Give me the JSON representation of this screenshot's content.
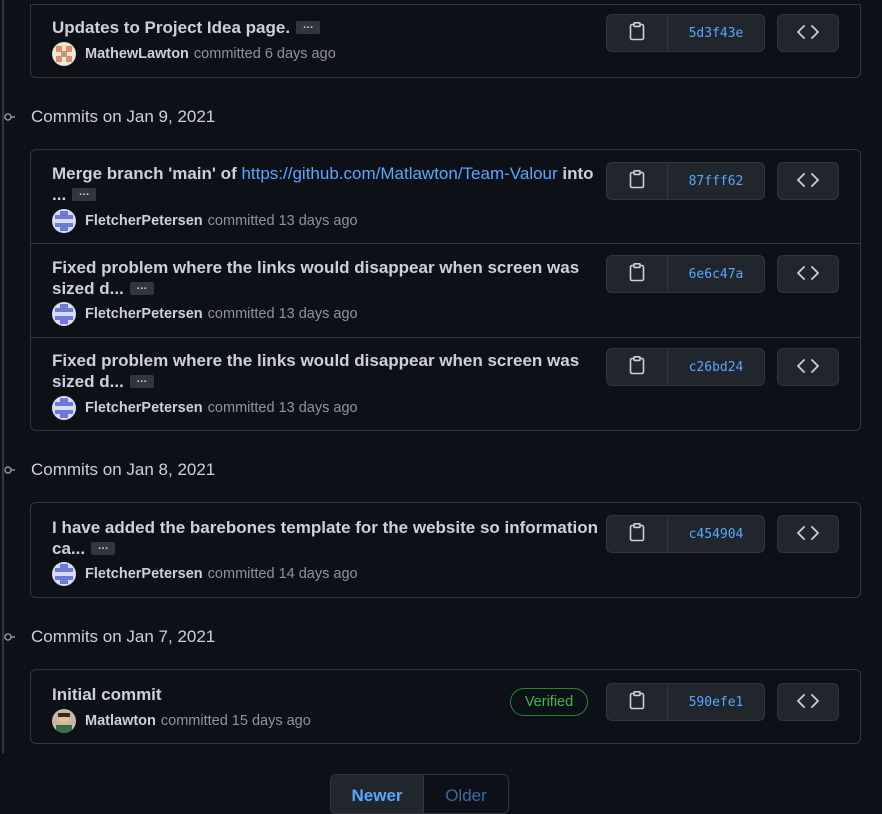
{
  "groups": [
    {
      "header": "",
      "commits": [
        {
          "message": "Updates to Project Idea page.",
          "link": "",
          "message_tail": "",
          "author": "MathewLawton",
          "action": "committed",
          "time": "6 days ago",
          "sha": "5d3f43e",
          "verified": ""
        }
      ]
    },
    {
      "header": "Commits on Jan 9, 2021",
      "commits": [
        {
          "message": "Merge branch 'main' of ",
          "link": "https://github.com/Matlawton/Team-Valour",
          "message_tail": " into ...",
          "author": "FletcherPetersen",
          "action": "committed",
          "time": "13 days ago",
          "sha": "87fff62",
          "verified": ""
        },
        {
          "message": "Fixed problem where the links would disappear when screen was sized d...",
          "link": "",
          "message_tail": "",
          "author": "FletcherPetersen",
          "action": "committed",
          "time": "13 days ago",
          "sha": "6e6c47a",
          "verified": ""
        },
        {
          "message": "Fixed problem where the links would disappear when screen was sized d...",
          "link": "",
          "message_tail": "",
          "author": "FletcherPetersen",
          "action": "committed",
          "time": "13 days ago",
          "sha": "c26bd24",
          "verified": ""
        }
      ]
    },
    {
      "header": "Commits on Jan 8, 2021",
      "commits": [
        {
          "message": "I have added the barebones template for the website so information ca...",
          "link": "",
          "message_tail": "",
          "author": "FletcherPetersen",
          "action": "committed",
          "time": "14 days ago",
          "sha": "c454904",
          "verified": ""
        }
      ]
    },
    {
      "header": "Commits on Jan 7, 2021",
      "commits": [
        {
          "message": "Initial commit",
          "link": "",
          "message_tail": "",
          "author": "Matlawton",
          "action": "committed",
          "time": "15 days ago",
          "sha": "590efe1",
          "verified": "Verified"
        }
      ]
    }
  ],
  "ellipsis_label": "…",
  "pagination": {
    "newer": "Newer",
    "older": "Older"
  },
  "icons": {
    "copy": "clipboard-icon",
    "browse": "code-icon",
    "timeline": "git-commit-icon"
  },
  "colors": {
    "background": "#0d1117",
    "border": "#30363d",
    "link": "#58a6ff",
    "verified": "#3fb950",
    "muted": "#8b949e",
    "text": "#c9d1d9"
  }
}
